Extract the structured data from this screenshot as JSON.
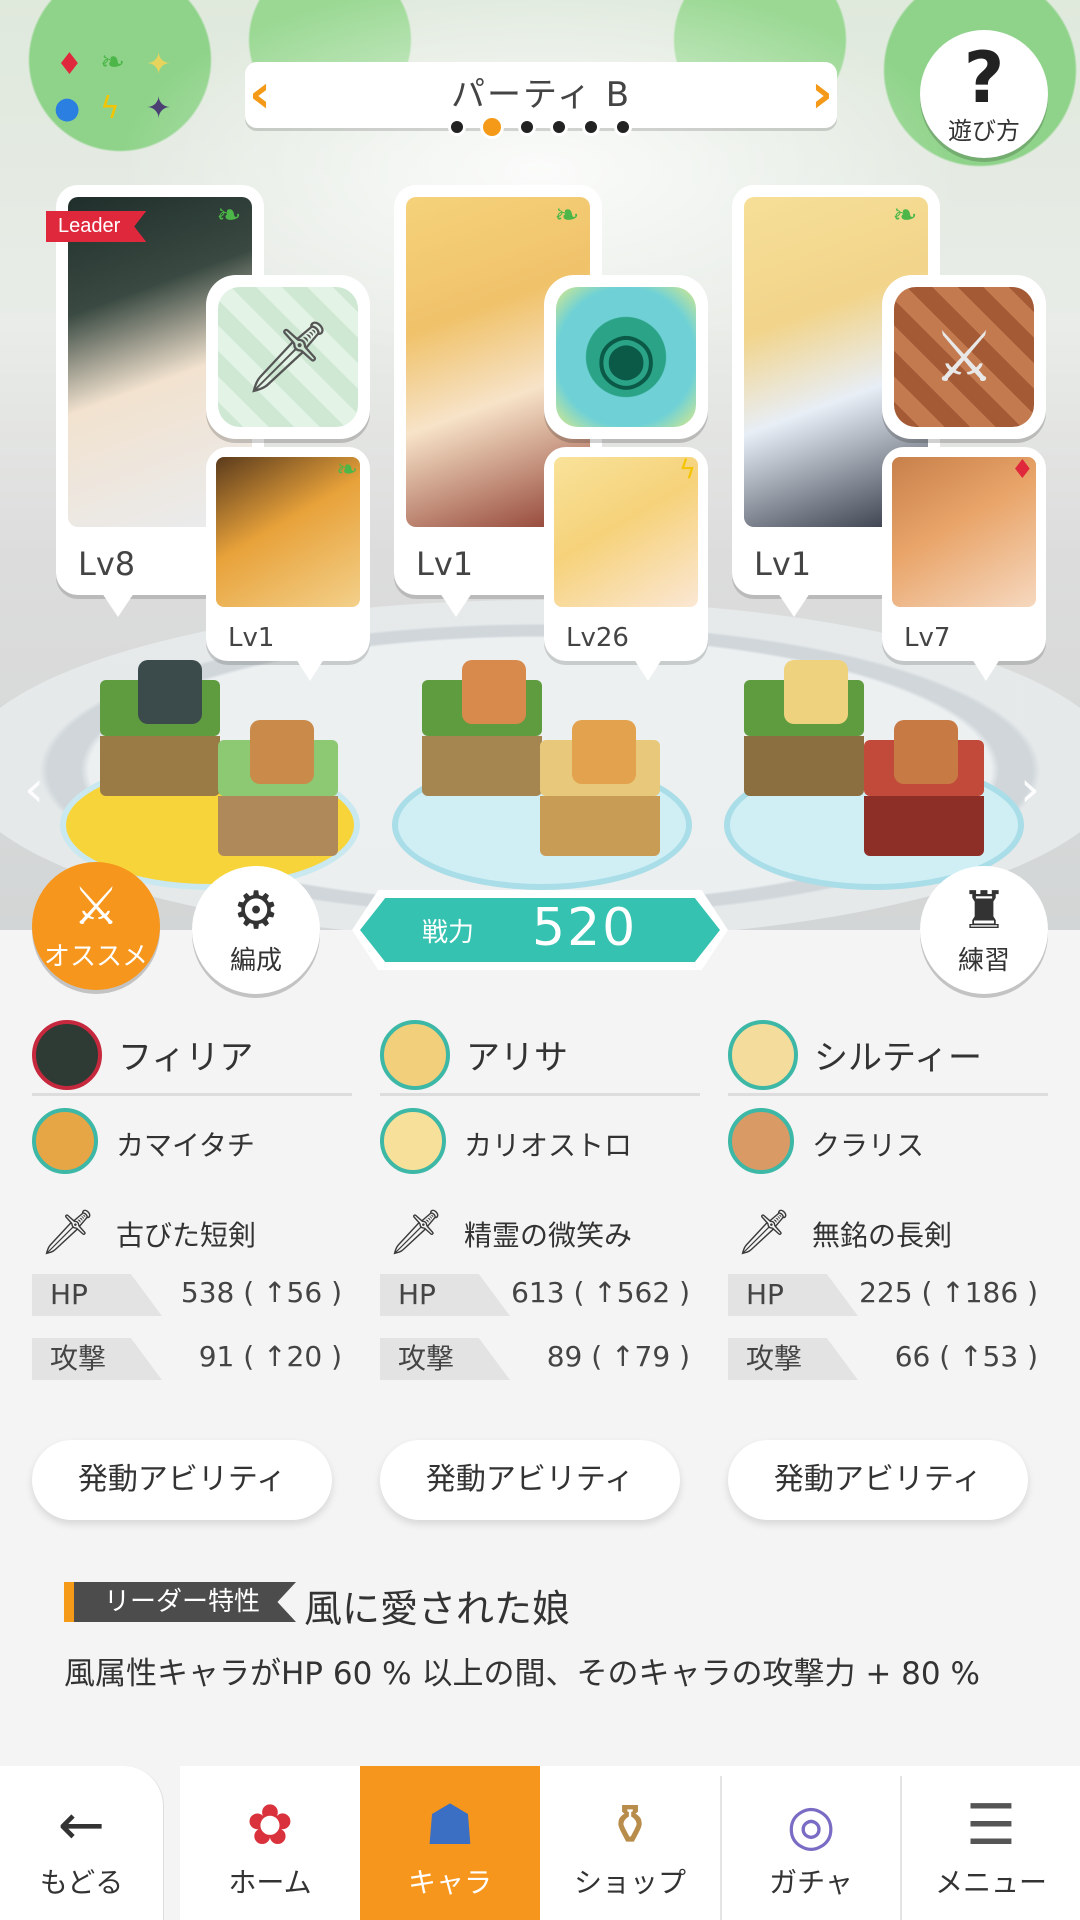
{
  "header": {
    "party_title": "パーティ B",
    "party_pages": 6,
    "active_page_index": 1,
    "help_label": "遊び方",
    "help_icon": "question-icon"
  },
  "element_icons": [
    "diamond-red",
    "leaf-green",
    "star-yellow",
    "circle-blue",
    "lightning-yellow",
    "star-purple"
  ],
  "members": [
    {
      "leader_badge": "Leader",
      "level": "Lv8",
      "element": "wind",
      "weapon_icon": "dagger-icon",
      "sub_level": "Lv1",
      "sub_element": "wind"
    },
    {
      "leader_badge": "",
      "level": "Lv1",
      "element": "wind",
      "weapon_icon": "orb-icon",
      "sub_level": "Lv26",
      "sub_element": "thunder"
    },
    {
      "leader_badge": "",
      "level": "Lv1",
      "element": "wind",
      "weapon_icon": "longsword-icon",
      "sub_level": "Lv7",
      "sub_element": "fire"
    }
  ],
  "buttons": {
    "recommend_label": "オススメ",
    "formation_label": "編成",
    "practice_label": "練習"
  },
  "power": {
    "label": "戦力",
    "value": "520"
  },
  "stats": [
    {
      "name": "フィリア",
      "sub_name": "カマイタチ",
      "weapon": "古びた短剣",
      "hp_label": "HP",
      "hp_value": "538 ( ↑56 )",
      "atk_label": "攻撃",
      "atk_value": "91 ( ↑20 )",
      "ability_button": "発動アビリティ"
    },
    {
      "name": "アリサ",
      "sub_name": "カリオストロ",
      "weapon": "精霊の微笑み",
      "hp_label": "HP",
      "hp_value": "613 ( ↑562 )",
      "atk_label": "攻撃",
      "atk_value": "89 ( ↑79 )",
      "ability_button": "発動アビリティ"
    },
    {
      "name": "シルティー",
      "sub_name": "クラリス",
      "weapon": "無銘の長剣",
      "hp_label": "HP",
      "hp_value": "225 ( ↑186 )",
      "atk_label": "攻撃",
      "atk_value": "66 ( ↑53 )",
      "ability_button": "発動アビリティ"
    }
  ],
  "leader_trait": {
    "tag": "リーダー特性",
    "name": "風に愛された娘",
    "description": "風属性キャラがHP 60 % 以上の間、そのキャラの攻撃力 + 80 %"
  },
  "nav": {
    "back": "もどる",
    "home": "ホーム",
    "chara": "キャラ",
    "shop": "ショップ",
    "gacha": "ガチャ",
    "menu": "メニュー",
    "active": "キャラ"
  },
  "colors": {
    "accent_orange": "#f7961d",
    "power_teal": "#35c2b0",
    "wind_green": "#4cb748",
    "leader_red": "#e0283d"
  }
}
